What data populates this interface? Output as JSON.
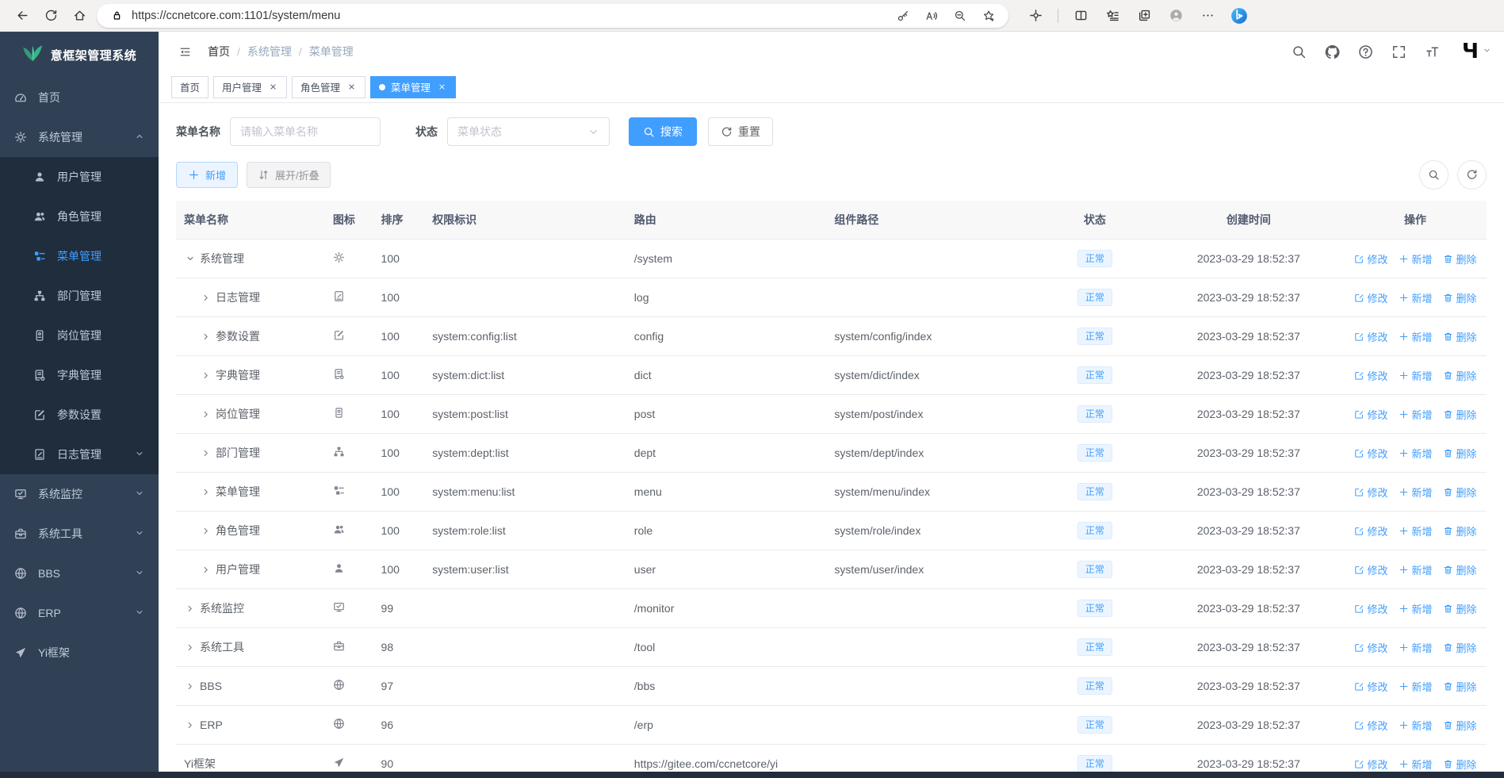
{
  "browser": {
    "url": "https://ccnetcore.com:1101/system/menu",
    "left_icons": [
      "back-icon",
      "reload-icon",
      "home-icon"
    ],
    "url_right_icons": [
      "key-icon",
      "read-aloud-icon",
      "zoom-out-icon",
      "star-add-icon"
    ],
    "right_icons": [
      "extensions-icon",
      "split-screen-icon",
      "favorites-icon",
      "collections-icon",
      "profile-icon",
      "more-icon",
      "bing-icon"
    ]
  },
  "sidebar": {
    "logo_title": "意框架管理系统",
    "items": [
      {
        "key": "home",
        "label": "首页",
        "icon": "dashboard-icon",
        "level": 0
      },
      {
        "key": "system",
        "label": "系统管理",
        "icon": "gear-icon",
        "level": 0,
        "chevron": "up"
      },
      {
        "key": "user",
        "label": "用户管理",
        "icon": "user-icon",
        "level": 1
      },
      {
        "key": "role",
        "label": "角色管理",
        "icon": "users-icon",
        "level": 1
      },
      {
        "key": "menu",
        "label": "菜单管理",
        "icon": "menu-list-icon",
        "level": 1,
        "active": true
      },
      {
        "key": "dept",
        "label": "部门管理",
        "icon": "org-tree-icon",
        "level": 1
      },
      {
        "key": "post",
        "label": "岗位管理",
        "icon": "post-badge-icon",
        "level": 1
      },
      {
        "key": "dict",
        "label": "字典管理",
        "icon": "dict-book-icon",
        "level": 1
      },
      {
        "key": "config",
        "label": "参数设置",
        "icon": "edit-square-icon",
        "level": 1
      },
      {
        "key": "log",
        "label": "日志管理",
        "icon": "log-doc-icon",
        "level": 1,
        "chevron": "down"
      },
      {
        "key": "monitor",
        "label": "系统监控",
        "icon": "monitor-icon",
        "level": 0,
        "chevron": "down"
      },
      {
        "key": "tool",
        "label": "系统工具",
        "icon": "toolbox-icon",
        "level": 0,
        "chevron": "down"
      },
      {
        "key": "bbs",
        "label": "BBS",
        "icon": "globe-icon",
        "level": 0,
        "chevron": "down"
      },
      {
        "key": "erp",
        "label": "ERP",
        "icon": "globe-icon",
        "level": 0,
        "chevron": "down"
      },
      {
        "key": "yi",
        "label": "Yi框架",
        "icon": "paper-plane-icon",
        "level": 0
      }
    ]
  },
  "navbar": {
    "breadcrumb": [
      "首页",
      "系统管理",
      "菜单管理"
    ],
    "right_icons": [
      "search-icon",
      "github-icon",
      "question-icon",
      "fullscreen-icon",
      "text-size-icon"
    ]
  },
  "tabs": [
    {
      "label": "首页",
      "closable": false,
      "active": false
    },
    {
      "label": "用户管理",
      "closable": true,
      "active": false
    },
    {
      "label": "角色管理",
      "closable": true,
      "active": false
    },
    {
      "label": "菜单管理",
      "closable": true,
      "active": true
    }
  ],
  "filters": {
    "menu_name_label": "菜单名称",
    "menu_name_placeholder": "请输入菜单名称",
    "status_label": "状态",
    "status_placeholder": "菜单状态",
    "search_label": "搜索",
    "reset_label": "重置"
  },
  "toolbar": {
    "add_label": "新增",
    "expand_label": "展开/折叠"
  },
  "table": {
    "columns": [
      "菜单名称",
      "图标",
      "排序",
      "权限标识",
      "路由",
      "组件路径",
      "状态",
      "创建时间",
      "操作"
    ],
    "actions": [
      "修改",
      "新增",
      "删除"
    ],
    "rows": [
      {
        "name": "系统管理",
        "arrow": "down",
        "indent": 0,
        "icon": "gear-icon",
        "order": "100",
        "perm": "",
        "route": "/system",
        "component": "",
        "status": "正常",
        "created": "2023-03-29 18:52:37"
      },
      {
        "name": "日志管理",
        "arrow": "right",
        "indent": 1,
        "icon": "log-doc-icon",
        "order": "100",
        "perm": "",
        "route": "log",
        "component": "",
        "status": "正常",
        "created": "2023-03-29 18:52:37"
      },
      {
        "name": "参数设置",
        "arrow": "right",
        "indent": 1,
        "icon": "edit-square-icon",
        "order": "100",
        "perm": "system:config:list",
        "route": "config",
        "component": "system/config/index",
        "status": "正常",
        "created": "2023-03-29 18:52:37"
      },
      {
        "name": "字典管理",
        "arrow": "right",
        "indent": 1,
        "icon": "dict-book-icon",
        "order": "100",
        "perm": "system:dict:list",
        "route": "dict",
        "component": "system/dict/index",
        "status": "正常",
        "created": "2023-03-29 18:52:37"
      },
      {
        "name": "岗位管理",
        "arrow": "right",
        "indent": 1,
        "icon": "post-badge-icon",
        "order": "100",
        "perm": "system:post:list",
        "route": "post",
        "component": "system/post/index",
        "status": "正常",
        "created": "2023-03-29 18:52:37"
      },
      {
        "name": "部门管理",
        "arrow": "right",
        "indent": 1,
        "icon": "org-tree-icon",
        "order": "100",
        "perm": "system:dept:list",
        "route": "dept",
        "component": "system/dept/index",
        "status": "正常",
        "created": "2023-03-29 18:52:37"
      },
      {
        "name": "菜单管理",
        "arrow": "right",
        "indent": 1,
        "icon": "menu-list-icon",
        "order": "100",
        "perm": "system:menu:list",
        "route": "menu",
        "component": "system/menu/index",
        "status": "正常",
        "created": "2023-03-29 18:52:37"
      },
      {
        "name": "角色管理",
        "arrow": "right",
        "indent": 1,
        "icon": "users-icon",
        "order": "100",
        "perm": "system:role:list",
        "route": "role",
        "component": "system/role/index",
        "status": "正常",
        "created": "2023-03-29 18:52:37"
      },
      {
        "name": "用户管理",
        "arrow": "right",
        "indent": 1,
        "icon": "user-icon",
        "order": "100",
        "perm": "system:user:list",
        "route": "user",
        "component": "system/user/index",
        "status": "正常",
        "created": "2023-03-29 18:52:37"
      },
      {
        "name": "系统监控",
        "arrow": "right",
        "indent": 0,
        "icon": "monitor-icon",
        "order": "99",
        "perm": "",
        "route": "/monitor",
        "component": "",
        "status": "正常",
        "created": "2023-03-29 18:52:37"
      },
      {
        "name": "系统工具",
        "arrow": "right",
        "indent": 0,
        "icon": "toolbox-icon",
        "order": "98",
        "perm": "",
        "route": "/tool",
        "component": "",
        "status": "正常",
        "created": "2023-03-29 18:52:37"
      },
      {
        "name": "BBS",
        "arrow": "right",
        "indent": 0,
        "icon": "globe-icon",
        "order": "97",
        "perm": "",
        "route": "/bbs",
        "component": "",
        "status": "正常",
        "created": "2023-03-29 18:52:37"
      },
      {
        "name": "ERP",
        "arrow": "right",
        "indent": 0,
        "icon": "globe-icon",
        "order": "96",
        "perm": "",
        "route": "/erp",
        "component": "",
        "status": "正常",
        "created": "2023-03-29 18:52:37"
      },
      {
        "name": "Yi框架",
        "arrow": null,
        "indent": 0,
        "icon": "paper-plane-icon",
        "order": "90",
        "perm": "",
        "route": "https://gitee.com/ccnetcore/yi",
        "component": "",
        "status": "正常",
        "created": "2023-03-29 18:52:37"
      }
    ]
  },
  "colors": {
    "accent": "#409eff",
    "sidebar_bg": "#304156",
    "sidebar_submenu_bg": "#1f2d3d",
    "sidebar_text": "#bfcbd9",
    "badge_bg": "#ecf5ff",
    "badge_border": "#d9ecff",
    "badge_text": "#409eff",
    "logo_green": "#36b389",
    "table_header_bg": "#f8f8f9"
  }
}
